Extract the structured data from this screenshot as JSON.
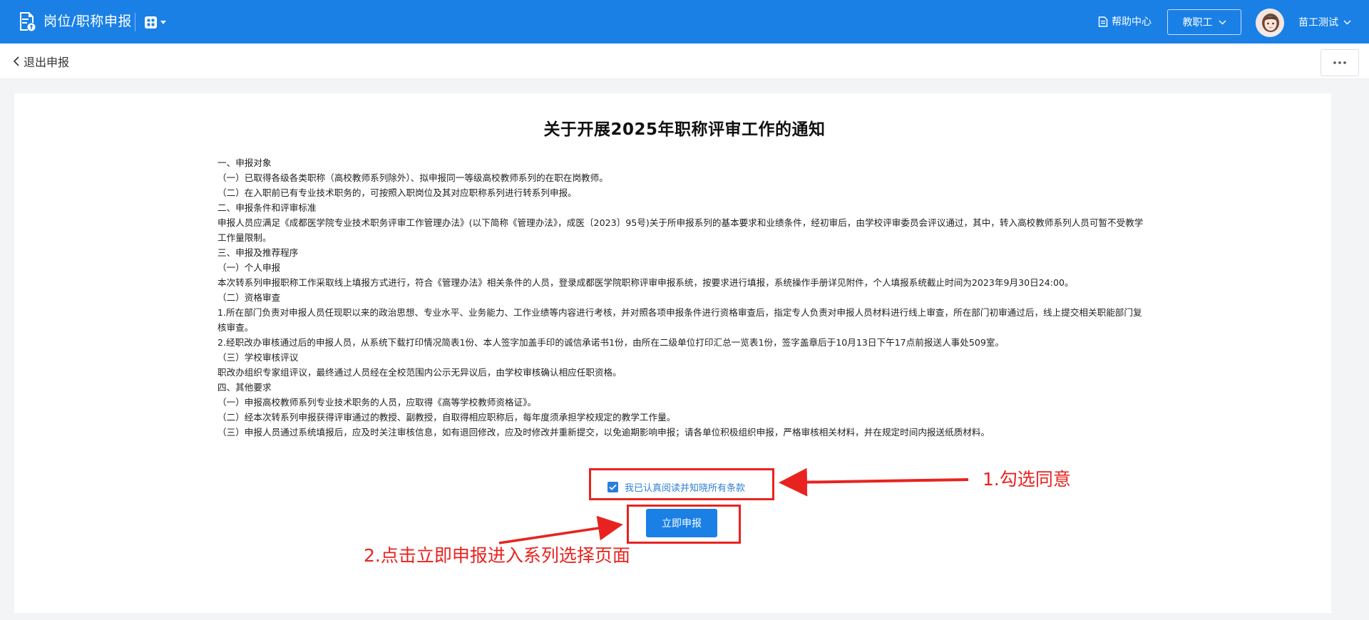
{
  "header": {
    "app_title": "岗位/职称申报",
    "help_label": "帮助中心",
    "role_label": "教职工",
    "user_name": "苗工测试",
    "bg_color": "#1a80e6",
    "icons": [
      "document-upload-icon",
      "apps-grid-icon",
      "chevron-down-icon",
      "help-document-icon",
      "avatar"
    ]
  },
  "subbar": {
    "exit_label": "退出申报",
    "more_icon": "more-dots-icon"
  },
  "notice": {
    "title": "关于开展2025年职称评审工作的通知",
    "lines": [
      "一、申报对象",
      "（一）已取得各级各类职称（高校教师系列除外）、拟申报同一等级高校教师系列的在职在岗教师。",
      "（二）在入职前已有专业技术职务的，可按照入职岗位及其对应职称系列进行转系列申报。",
      "二、申报条件和评审标准",
      "申报人员应满足《成都医学院专业技术职务评审工作管理办法》(以下简称《管理办法》，成医〔2023〕95号)关于所申报系列的基本要求和业绩条件，经初审后，由学校评审委员会评议通过，其中，转入高校教师系列人员可暂不受教学工作量限制。",
      "三、申报及推荐程序",
      "（一）个人申报",
      "本次转系列申报职称工作采取线上填报方式进行，符合《管理办法》相关条件的人员，登录成都医学院职称评审申报系统，按要求进行填报，系统操作手册详见附件，个人填报系统截止时间为2023年9月30日24:00。",
      "（二）资格审查",
      "1.所在部门负责对申报人员任现职以来的政治思想、专业水平、业务能力、工作业绩等内容进行考核，并对照各项申报条件进行资格审查后，指定专人负责对申报人员材料进行线上审查，所在部门初审通过后，线上提交相关职能部门复核审查。",
      "2.经职改办审核通过后的申报人员，从系统下载打印情况简表1份、本人签字加盖手印的诚信承诺书1份，由所在二级单位打印汇总一览表1份，签字盖章后于10月13日下午17点前报送人事处509室。",
      "（三）学校审核评议",
      "职改办组织专家组评议，最终通过人员经在全校范围内公示无异议后，由学校审核确认相应任职资格。",
      "四、其他要求",
      "（一）申报高校教师系列专业技术职务的人员，应取得《高等学校教师资格证》。",
      "（二）经本次转系列申报获得评审通过的教授、副教授，自取得相应职称后，每年度须承担学校规定的教学工作量。",
      "（三）申报人员通过系统填报后，应及时关注审核信息，如有退回修改，应及时修改并重新提交，以免逾期影响申报；请各单位积极组织申报，严格审核相关材料，并在规定时间内报送纸质材料。"
    ]
  },
  "agree": {
    "label": "我已认真阅读并知晓所有条款",
    "checked": true
  },
  "submit": {
    "label": "立即申报"
  },
  "annotations": {
    "step1": "1.勾选同意",
    "step2": "2.点击立即申报进入系列选择页面",
    "color": "#e8231f"
  }
}
